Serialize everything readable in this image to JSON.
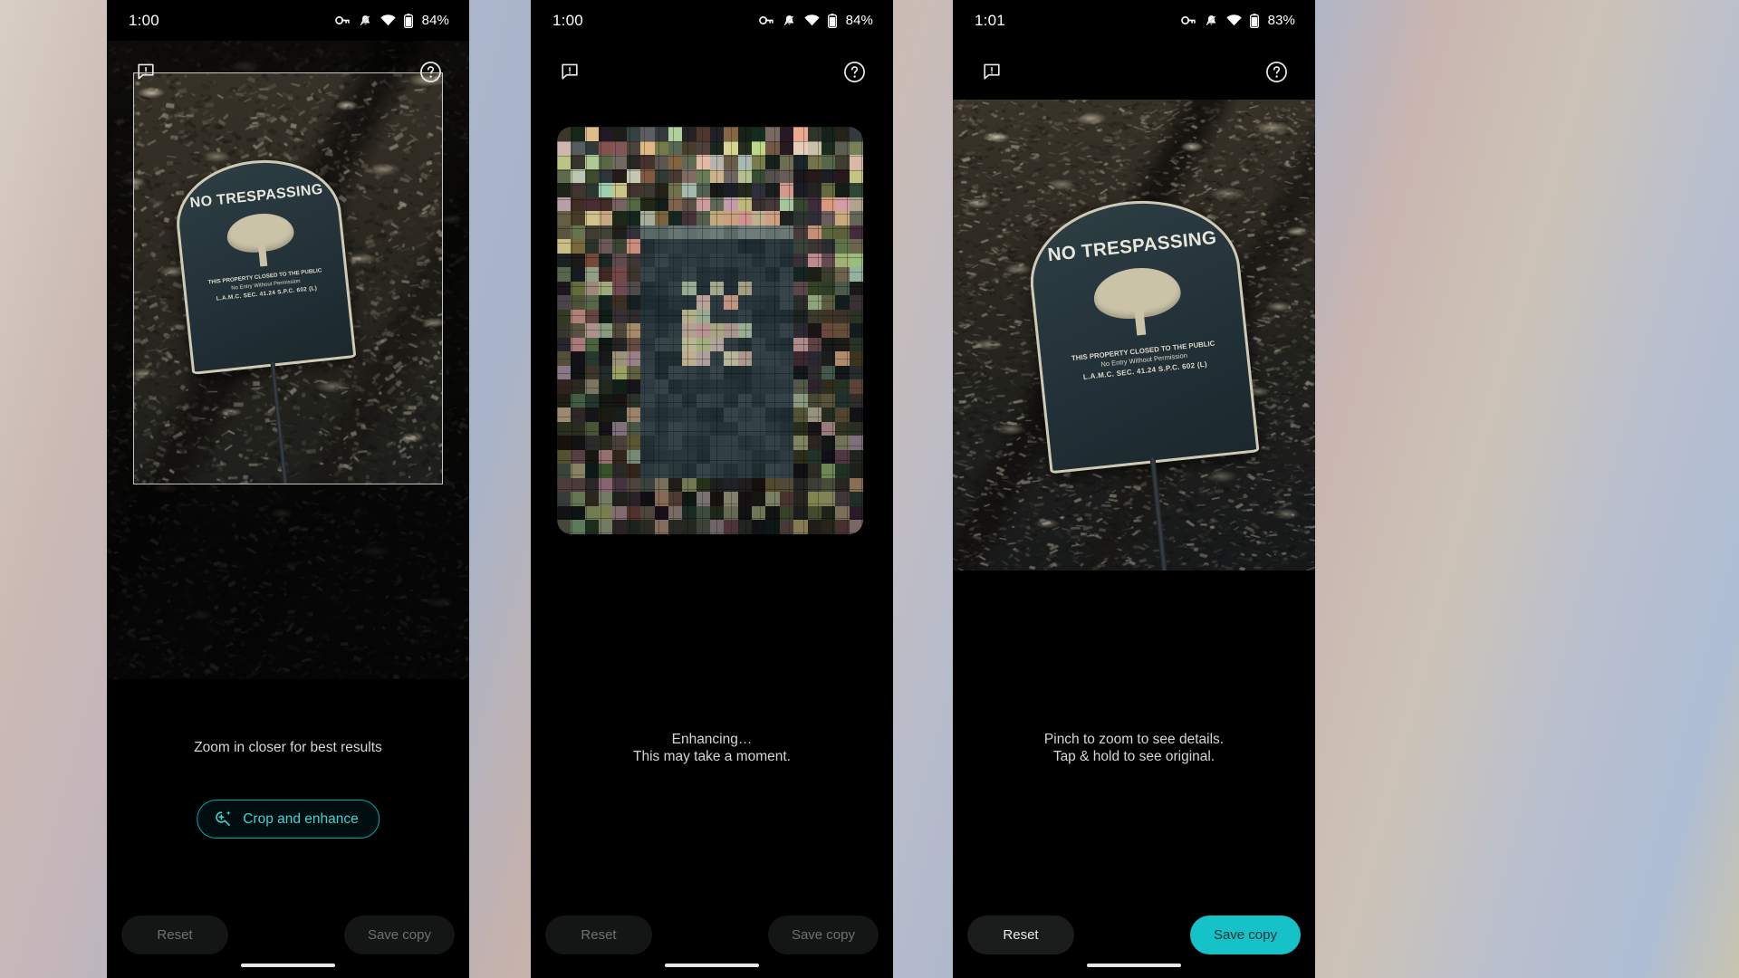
{
  "app": {
    "name": "Google Photos Unblur",
    "accent_teal": "#14c2c8",
    "accent_outline": "#00a9a9",
    "accent_text": "#3fd3d3"
  },
  "phones": [
    {
      "id": "phone-crop",
      "status": {
        "time": "1:00",
        "battery_percent": "84%",
        "icons": [
          "vpn-key-icon",
          "notifications-muted-icon",
          "wifi-icon",
          "battery-icon"
        ]
      },
      "top_actions": {
        "feedback_label": "feedback-icon",
        "help_label": "help-icon"
      },
      "caption": "Zoom in closer for best results",
      "primary_button": {
        "label": "Crop and enhance",
        "icon": "crop-and-enhance-icon",
        "state": "enabled"
      },
      "bottom_buttons": [
        {
          "label": "Reset",
          "state": "disabled"
        },
        {
          "label": "Save copy",
          "state": "disabled"
        }
      ],
      "photo": {
        "subject": "NO TRESPASSING sign in woods",
        "selection_rect": true
      }
    },
    {
      "id": "phone-enhancing",
      "status": {
        "time": "1:00",
        "battery_percent": "84%",
        "icons": [
          "vpn-key-icon",
          "notifications-muted-icon",
          "wifi-icon",
          "battery-icon"
        ]
      },
      "top_actions": {
        "feedback_label": "feedback-icon",
        "help_label": "help-icon"
      },
      "caption_line_1": "Enhancing…",
      "caption_line_2": "This may take a moment.",
      "bottom_buttons": [
        {
          "label": "Reset",
          "state": "disabled"
        },
        {
          "label": "Save copy",
          "state": "disabled"
        }
      ],
      "photo": {
        "subject": "pixelated NO TRESPASSING sign",
        "pixelated": true
      }
    },
    {
      "id": "phone-result",
      "status": {
        "time": "1:01",
        "battery_percent": "83%",
        "icons": [
          "vpn-key-icon",
          "notifications-muted-icon",
          "wifi-icon",
          "battery-icon"
        ]
      },
      "top_actions": {
        "feedback_label": "feedback-icon",
        "help_label": "help-icon"
      },
      "caption_line_1": "Pinch to zoom to see details.",
      "caption_line_2": "Tap & hold to see original.",
      "bottom_buttons": [
        {
          "label": "Reset",
          "state": "enabled"
        },
        {
          "label": "Save copy",
          "state": "primary"
        }
      ],
      "photo": {
        "subject": "sharpened NO TRESPASSING sign"
      }
    }
  ],
  "sign": {
    "title": "NO TRESPASSING",
    "line_1": "THIS PROPERTY CLOSED TO THE PUBLIC",
    "line_2": "No Entry Without Permission",
    "line_3": "L.A.M.C. SEC. 41.24      S.P.C. 602 (L)",
    "emblem": "tree-icon"
  }
}
